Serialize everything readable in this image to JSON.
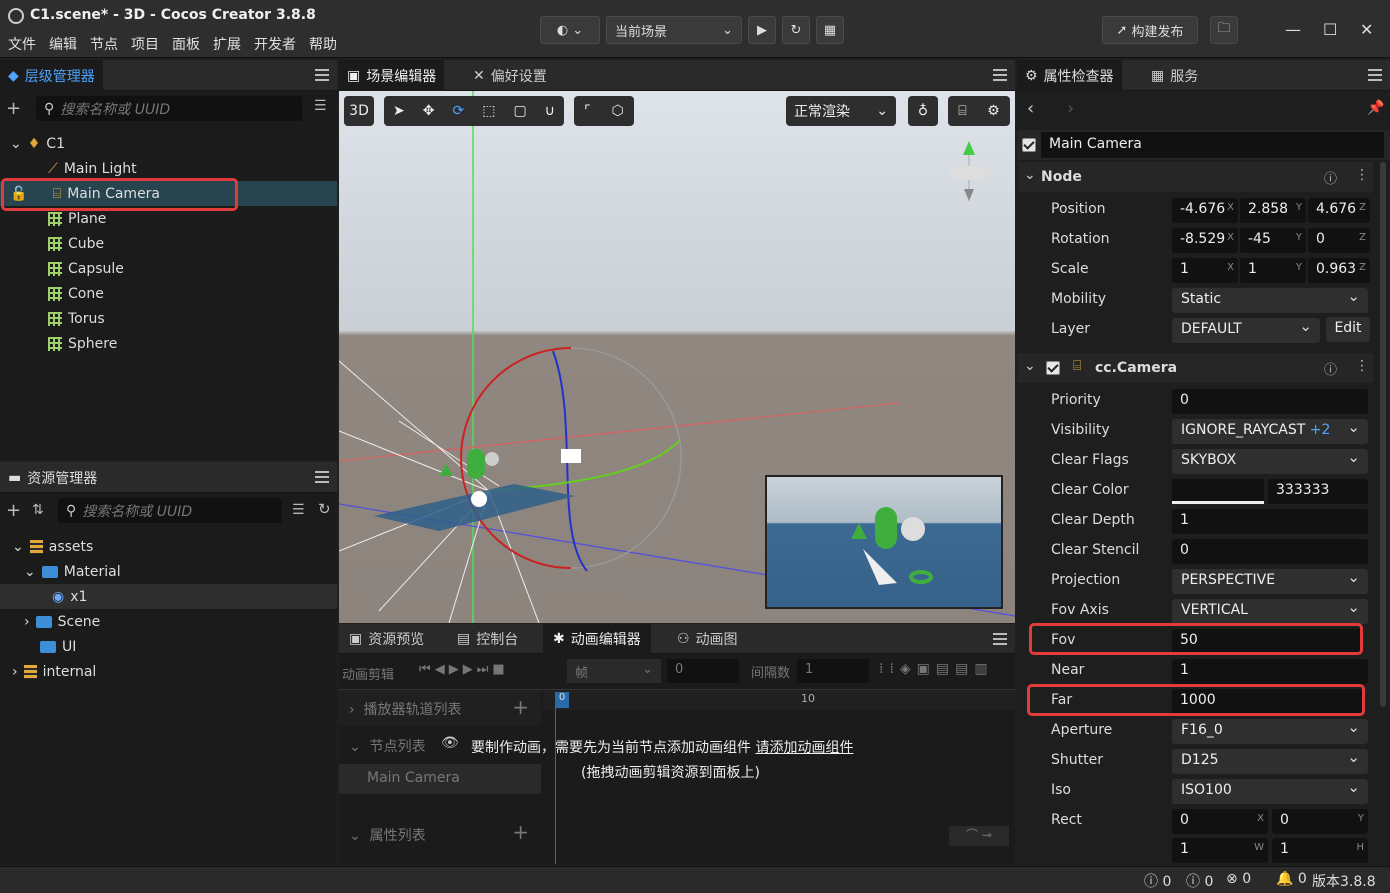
{
  "window": {
    "title": "C1.scene* - 3D - Cocos Creator 3.8.8"
  },
  "menu": [
    "文件",
    "编辑",
    "节点",
    "项目",
    "面板",
    "扩展",
    "开发者",
    "帮助"
  ],
  "toolbar": {
    "scene_select": "当前场景",
    "build_label": "构建发布"
  },
  "hierarchy": {
    "tab": "层级管理器",
    "search_placeholder": "搜索名称或 UUID",
    "root": "C1",
    "items": [
      "Main Light",
      "Main Camera",
      "Plane",
      "Cube",
      "Capsule",
      "Cone",
      "Torus",
      "Sphere"
    ]
  },
  "assets": {
    "tab": "资源管理器",
    "search_placeholder": "搜索名称或 UUID",
    "items": [
      "assets",
      "Material",
      "x1",
      "Scene",
      "UI",
      "internal"
    ]
  },
  "scene": {
    "tabs": [
      "场景编辑器",
      "偏好设置"
    ],
    "mode_3d": "3D",
    "render_mode": "正常渲染"
  },
  "bottom": {
    "tabs": [
      "资源预览",
      "控制台",
      "动画编辑器",
      "动画图"
    ],
    "clip_label": "动画剪辑",
    "frame_label": "帧",
    "frame_value": "0",
    "interval_label": "间隔数",
    "interval_value": "1",
    "tick_0": "0",
    "tick_10": "10",
    "player_track": "播放器轨道列表",
    "node_list": "节点列表",
    "node_name": "Main Camera",
    "prop_list": "属性列表",
    "msg_prefix": "要制作动画，需要先为当前节点添加动画组件",
    "msg_link": "请添加动画组件",
    "msg_hint": "(拖拽动画剪辑资源到面板上)"
  },
  "inspector": {
    "tabs": [
      "属性检查器",
      "服务"
    ],
    "node_name": "Main Camera",
    "node_section": "Node",
    "position": {
      "label": "Position",
      "x": "-4.676",
      "y": "2.858",
      "z": "4.676"
    },
    "rotation": {
      "label": "Rotation",
      "x": "-8.529",
      "y": "-45",
      "z": "0"
    },
    "scale": {
      "label": "Scale",
      "x": "1",
      "y": "1",
      "z": "0.963"
    },
    "mobility": {
      "label": "Mobility",
      "value": "Static"
    },
    "layer": {
      "label": "Layer",
      "value": "DEFAULT",
      "edit": "Edit"
    },
    "camera_section": "cc.Camera",
    "priority": {
      "label": "Priority",
      "value": "0"
    },
    "visibility": {
      "label": "Visibility",
      "value": "IGNORE_RAYCAST",
      "extra": "+2"
    },
    "clear_flags": {
      "label": "Clear Flags",
      "value": "SKYBOX"
    },
    "clear_color": {
      "label": "Clear Color",
      "value": "333333"
    },
    "clear_depth": {
      "label": "Clear Depth",
      "value": "1"
    },
    "clear_stencil": {
      "label": "Clear Stencil",
      "value": "0"
    },
    "projection": {
      "label": "Projection",
      "value": "PERSPECTIVE"
    },
    "fov_axis": {
      "label": "Fov Axis",
      "value": "VERTICAL"
    },
    "fov": {
      "label": "Fov",
      "value": "50"
    },
    "near": {
      "label": "Near",
      "value": "1"
    },
    "far": {
      "label": "Far",
      "value": "1000"
    },
    "aperture": {
      "label": "Aperture",
      "value": "F16_0"
    },
    "shutter": {
      "label": "Shutter",
      "value": "D125"
    },
    "iso": {
      "label": "Iso",
      "value": "ISO100"
    },
    "rect": {
      "label": "Rect",
      "x": "0",
      "y": "0",
      "w": "1",
      "h": "1"
    }
  },
  "status": {
    "info": "0",
    "warn": "0",
    "error": "0",
    "notif": "0",
    "version": "版本3.8.8"
  }
}
